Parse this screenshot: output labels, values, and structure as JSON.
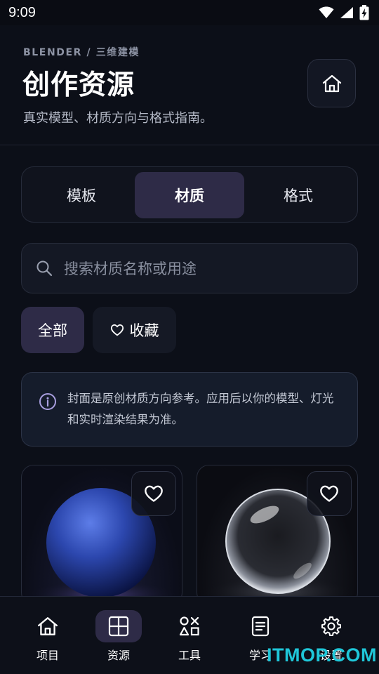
{
  "status_bar": {
    "time": "9:09"
  },
  "header": {
    "breadcrumb": "BLENDER / 三维建模",
    "title": "创作资源",
    "subtitle": "真实模型、材质方向与格式指南。"
  },
  "tabs": [
    {
      "label": "模板",
      "active": false
    },
    {
      "label": "材质",
      "active": true
    },
    {
      "label": "格式",
      "active": false
    }
  ],
  "search": {
    "placeholder": "搜索材质名称或用途"
  },
  "filters": {
    "all": "全部",
    "favorites": "收藏"
  },
  "notice": {
    "text": "封面是原创材质方向参考。应用后以你的模型、灯光和实时渲染结果为准。"
  },
  "cards": [
    {
      "icon": "heart-icon",
      "color": "#2f49a8"
    },
    {
      "icon": "heart-icon",
      "color": "#cfd3da"
    }
  ],
  "bottom_nav": [
    {
      "label": "项目",
      "icon": "home-icon",
      "active": false
    },
    {
      "label": "资源",
      "icon": "grid-icon",
      "active": true
    },
    {
      "label": "工具",
      "icon": "tools-icon",
      "active": false
    },
    {
      "label": "学习",
      "icon": "document-icon",
      "active": false
    },
    {
      "label": "设置",
      "icon": "gear-icon",
      "active": false
    }
  ],
  "watermark": "ITMOP.COM",
  "colors": {
    "accent": "#2e2b47",
    "background": "#0c0f18"
  }
}
